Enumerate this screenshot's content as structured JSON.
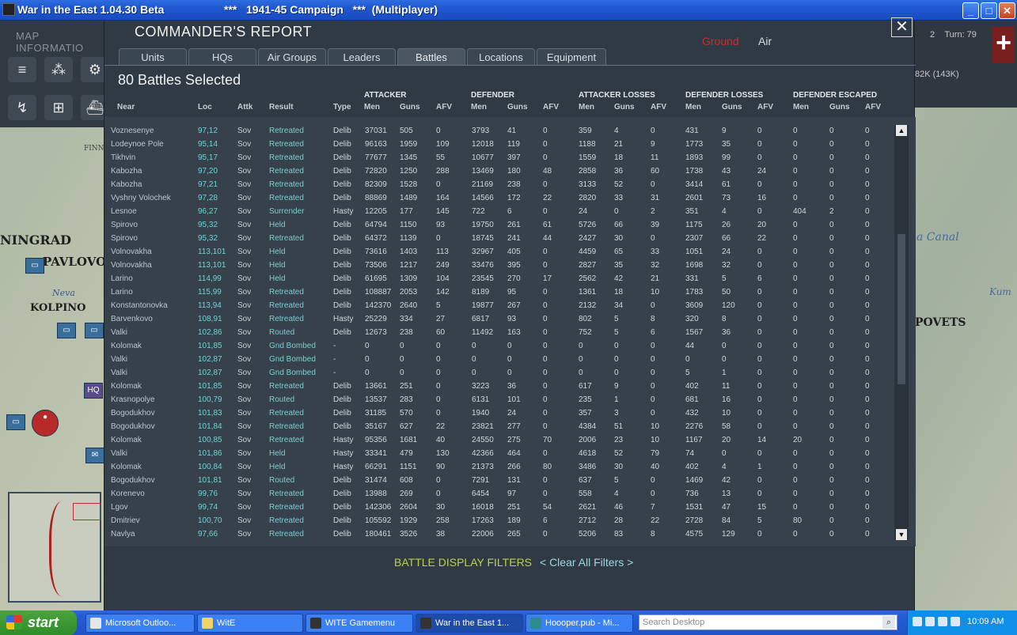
{
  "window": {
    "title": "War in the East 1.04.30 Beta",
    "subtitle": "***   1941-45 Campaign   ***  (Multiplayer)",
    "controls": {
      "minimize": "_",
      "maximize": "□",
      "close": "✕"
    }
  },
  "map": {
    "info_label": "MAP INFORMATIO",
    "turn": "Turn: 79",
    "turn_prefix": "2",
    "men": "82K (143K)",
    "labels": {
      "leningrad": "NINGRAD",
      "pavlovo": "PAVLOVO",
      "kolpino": "KOLPINO",
      "neva": "Neva",
      "finnish": "FINNISH",
      "canal": "a Canal",
      "kum": "Kum",
      "povets": "POVETS",
      "hq": "HQ"
    }
  },
  "report": {
    "title": "COMMANDER'S REPORT",
    "filters": {
      "ground": "Ground",
      "air": "Air"
    },
    "close": "✕",
    "tabs": [
      "Units",
      "HQs",
      "Air Groups",
      "Leaders",
      "Battles",
      "Locations",
      "Equipment"
    ],
    "active_tab": "Battles",
    "selected_title": "80 Battles Selected",
    "group_headers": {
      "attacker": "ATTACKER",
      "defender": "DEFENDER",
      "attacker_losses": "ATTACKER LOSSES",
      "defender_losses": "DEFENDER LOSSES",
      "defender_escaped": "DEFENDER ESCAPED"
    },
    "columns": [
      "Near",
      "Loc",
      "Attk",
      "Result",
      "Type",
      "Men",
      "Guns",
      "AFV",
      "Men",
      "Guns",
      "AFV",
      "Men",
      "Guns",
      "AFV",
      "Men",
      "Guns",
      "AFV",
      "Men",
      "Guns",
      "AFV"
    ],
    "rows": [
      [
        "Voznesenye",
        "97,12",
        "Sov",
        "Retreated",
        "Delib",
        "37031",
        "505",
        "0",
        "3793",
        "41",
        "0",
        "359",
        "4",
        "0",
        "431",
        "9",
        "0",
        "0",
        "0",
        "0"
      ],
      [
        "Lodeynoe Pole",
        "95,14",
        "Sov",
        "Retreated",
        "Delib",
        "96163",
        "1959",
        "109",
        "12018",
        "119",
        "0",
        "1188",
        "21",
        "9",
        "1773",
        "35",
        "0",
        "0",
        "0",
        "0"
      ],
      [
        "Tikhvin",
        "95,17",
        "Sov",
        "Retreated",
        "Delib",
        "77677",
        "1345",
        "55",
        "10677",
        "397",
        "0",
        "1559",
        "18",
        "11",
        "1893",
        "99",
        "0",
        "0",
        "0",
        "0"
      ],
      [
        "Kabozha",
        "97,20",
        "Sov",
        "Retreated",
        "Delib",
        "72820",
        "1250",
        "288",
        "13469",
        "180",
        "48",
        "2858",
        "36",
        "60",
        "1738",
        "43",
        "24",
        "0",
        "0",
        "0"
      ],
      [
        "Kabozha",
        "97,21",
        "Sov",
        "Retreated",
        "Delib",
        "82309",
        "1528",
        "0",
        "21169",
        "238",
        "0",
        "3133",
        "52",
        "0",
        "3414",
        "61",
        "0",
        "0",
        "0",
        "0"
      ],
      [
        "Vyshny Volochek",
        "97,28",
        "Sov",
        "Retreated",
        "Delib",
        "88869",
        "1489",
        "164",
        "14566",
        "172",
        "22",
        "2820",
        "33",
        "31",
        "2601",
        "73",
        "16",
        "0",
        "0",
        "0"
      ],
      [
        "Lesnoe",
        "96,27",
        "Sov",
        "Surrender",
        "Hasty",
        "12205",
        "177",
        "145",
        "722",
        "6",
        "0",
        "24",
        "0",
        "2",
        "351",
        "4",
        "0",
        "404",
        "2",
        "0"
      ],
      [
        "Spirovo",
        "95,32",
        "Sov",
        "Held",
        "Delib",
        "64794",
        "1150",
        "93",
        "19750",
        "261",
        "61",
        "5726",
        "66",
        "39",
        "1175",
        "26",
        "20",
        "0",
        "0",
        "0"
      ],
      [
        "Spirovo",
        "95,32",
        "Sov",
        "Retreated",
        "Delib",
        "64372",
        "1139",
        "0",
        "18745",
        "241",
        "44",
        "2427",
        "30",
        "0",
        "2307",
        "66",
        "22",
        "0",
        "0",
        "0"
      ],
      [
        "Volnovakha",
        "113,101",
        "Sov",
        "Held",
        "Delib",
        "73616",
        "1403",
        "113",
        "32967",
        "405",
        "0",
        "4459",
        "65",
        "33",
        "1051",
        "24",
        "0",
        "0",
        "0",
        "0"
      ],
      [
        "Volnovakha",
        "113,101",
        "Sov",
        "Held",
        "Delib",
        "73506",
        "1217",
        "249",
        "33476",
        "395",
        "0",
        "2827",
        "35",
        "32",
        "1698",
        "32",
        "0",
        "0",
        "0",
        "0"
      ],
      [
        "Larino",
        "114,99",
        "Sov",
        "Held",
        "Delib",
        "61695",
        "1309",
        "104",
        "23545",
        "270",
        "17",
        "2562",
        "42",
        "21",
        "331",
        "5",
        "6",
        "0",
        "0",
        "0"
      ],
      [
        "Larino",
        "115,99",
        "Sov",
        "Retreated",
        "Delib",
        "108887",
        "2053",
        "142",
        "8189",
        "95",
        "0",
        "1361",
        "18",
        "10",
        "1783",
        "50",
        "0",
        "0",
        "0",
        "0"
      ],
      [
        "Konstantonovka",
        "113,94",
        "Sov",
        "Retreated",
        "Delib",
        "142370",
        "2640",
        "5",
        "19877",
        "267",
        "0",
        "2132",
        "34",
        "0",
        "3609",
        "120",
        "0",
        "0",
        "0",
        "0"
      ],
      [
        "Barvenkovo",
        "108,91",
        "Sov",
        "Retreated",
        "Hasty",
        "25229",
        "334",
        "27",
        "6817",
        "93",
        "0",
        "802",
        "5",
        "8",
        "320",
        "8",
        "0",
        "0",
        "0",
        "0"
      ],
      [
        "Valki",
        "102,86",
        "Sov",
        "Routed",
        "Delib",
        "12673",
        "238",
        "60",
        "11492",
        "163",
        "0",
        "752",
        "5",
        "6",
        "1567",
        "36",
        "0",
        "0",
        "0",
        "0"
      ],
      [
        "Kolomak",
        "101,85",
        "Sov",
        "Gnd Bombed",
        "-",
        "0",
        "0",
        "0",
        "0",
        "0",
        "0",
        "0",
        "0",
        "0",
        "44",
        "0",
        "0",
        "0",
        "0",
        "0"
      ],
      [
        "Valki",
        "102,87",
        "Sov",
        "Gnd Bombed",
        "-",
        "0",
        "0",
        "0",
        "0",
        "0",
        "0",
        "0",
        "0",
        "0",
        "0",
        "0",
        "0",
        "0",
        "0",
        "0"
      ],
      [
        "Valki",
        "102,87",
        "Sov",
        "Gnd Bombed",
        "-",
        "0",
        "0",
        "0",
        "0",
        "0",
        "0",
        "0",
        "0",
        "0",
        "5",
        "1",
        "0",
        "0",
        "0",
        "0"
      ],
      [
        "Kolomak",
        "101,85",
        "Sov",
        "Retreated",
        "Delib",
        "13661",
        "251",
        "0",
        "3223",
        "36",
        "0",
        "617",
        "9",
        "0",
        "402",
        "11",
        "0",
        "0",
        "0",
        "0"
      ],
      [
        "Krasnopolye",
        "100,79",
        "Sov",
        "Routed",
        "Delib",
        "13537",
        "283",
        "0",
        "6131",
        "101",
        "0",
        "235",
        "1",
        "0",
        "681",
        "16",
        "0",
        "0",
        "0",
        "0"
      ],
      [
        "Bogodukhov",
        "101,83",
        "Sov",
        "Retreated",
        "Delib",
        "31185",
        "570",
        "0",
        "1940",
        "24",
        "0",
        "357",
        "3",
        "0",
        "432",
        "10",
        "0",
        "0",
        "0",
        "0"
      ],
      [
        "Bogodukhov",
        "101,84",
        "Sov",
        "Retreated",
        "Delib",
        "35167",
        "627",
        "22",
        "23821",
        "277",
        "0",
        "4384",
        "51",
        "10",
        "2276",
        "58",
        "0",
        "0",
        "0",
        "0"
      ],
      [
        "Kolomak",
        "100,85",
        "Sov",
        "Retreated",
        "Hasty",
        "95356",
        "1681",
        "40",
        "24550",
        "275",
        "70",
        "2006",
        "23",
        "10",
        "1167",
        "20",
        "14",
        "20",
        "0",
        "0"
      ],
      [
        "Valki",
        "101,86",
        "Sov",
        "Held",
        "Hasty",
        "33341",
        "479",
        "130",
        "42366",
        "464",
        "0",
        "4618",
        "52",
        "79",
        "74",
        "0",
        "0",
        "0",
        "0",
        "0"
      ],
      [
        "Kolomak",
        "100,84",
        "Sov",
        "Held",
        "Hasty",
        "66291",
        "1151",
        "90",
        "21373",
        "266",
        "80",
        "3486",
        "30",
        "40",
        "402",
        "4",
        "1",
        "0",
        "0",
        "0"
      ],
      [
        "Bogodukhov",
        "101,81",
        "Sov",
        "Routed",
        "Delib",
        "31474",
        "608",
        "0",
        "7291",
        "131",
        "0",
        "637",
        "5",
        "0",
        "1469",
        "42",
        "0",
        "0",
        "0",
        "0"
      ],
      [
        "Korenevo",
        "99,76",
        "Sov",
        "Retreated",
        "Delib",
        "13988",
        "269",
        "0",
        "6454",
        "97",
        "0",
        "558",
        "4",
        "0",
        "736",
        "13",
        "0",
        "0",
        "0",
        "0"
      ],
      [
        "Lgov",
        "99,74",
        "Sov",
        "Retreated",
        "Delib",
        "142306",
        "2604",
        "30",
        "16018",
        "251",
        "54",
        "2621",
        "46",
        "7",
        "1531",
        "47",
        "15",
        "0",
        "0",
        "0"
      ],
      [
        "Dmitriev",
        "100,70",
        "Sov",
        "Retreated",
        "Delib",
        "105592",
        "1929",
        "258",
        "17263",
        "189",
        "6",
        "2712",
        "28",
        "22",
        "2728",
        "84",
        "5",
        "80",
        "0",
        "0"
      ],
      [
        "Navlya",
        "97,66",
        "Sov",
        "Retreated",
        "Delib",
        "180461",
        "3526",
        "38",
        "22006",
        "265",
        "0",
        "5206",
        "83",
        "8",
        "4575",
        "129",
        "0",
        "0",
        "0",
        "0"
      ]
    ],
    "battle_display_filters": "BATTLE DISPLAY FILTERS",
    "clear_all_filters": "< Clear All Filters >",
    "scroll": {
      "up": "▲",
      "down": "▼"
    }
  },
  "taskbar": {
    "start": "start",
    "tasks": [
      "Microsoft Outloo...",
      "WitE",
      "WITE Gamemenu",
      "War in the East 1...",
      "Hoooper.pub - Mi..."
    ],
    "active_task": "War in the East 1...",
    "search_placeholder": "Search Desktop",
    "time": "10:09 AM"
  },
  "colors": {
    "panel": "#2f3a44",
    "cyan_text": "#6fd4d4",
    "filter_green": "#b9d24a",
    "ground_red": "#c8302a"
  }
}
